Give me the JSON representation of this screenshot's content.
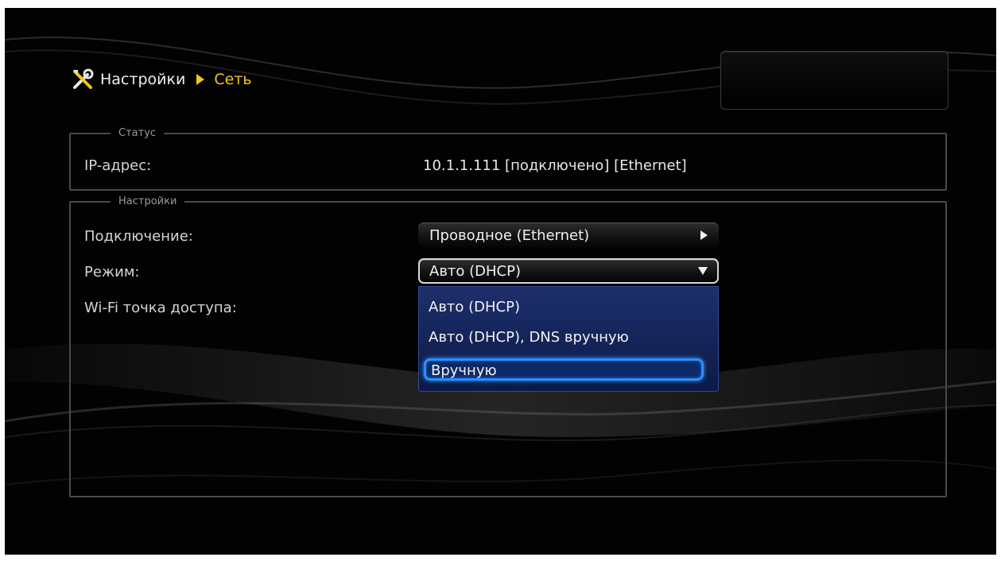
{
  "breadcrumb": {
    "root": "Настройки",
    "current": "Сеть"
  },
  "status": {
    "legend": "Статус",
    "ip_label": "IP-адрес:",
    "ip_value": "10.1.1.111 [подключено] [Ethernet]"
  },
  "settings": {
    "legend": "Настройки",
    "connection_label": "Подключение:",
    "connection_value": "Проводное (Ethernet)",
    "mode_label": "Режим:",
    "mode_value": "Авто (DHCP)",
    "wifi_label": "Wi-Fi точка доступа:"
  },
  "mode_dropdown": {
    "options": [
      "Авто (DHCP)",
      "Авто (DHCP), DNS вручную",
      "Вручную"
    ],
    "highlighted_index": 2
  },
  "colors": {
    "accent": "#f5c518",
    "focus": "#2a8fff",
    "dropdown_bg": "#1e2f6c"
  },
  "icons": {
    "breadcrumb_icon": "tools-icon",
    "separator_icon": "triangle-right-icon",
    "connection_arrow": "arrow-right-icon",
    "mode_arrow": "arrow-down-icon"
  }
}
